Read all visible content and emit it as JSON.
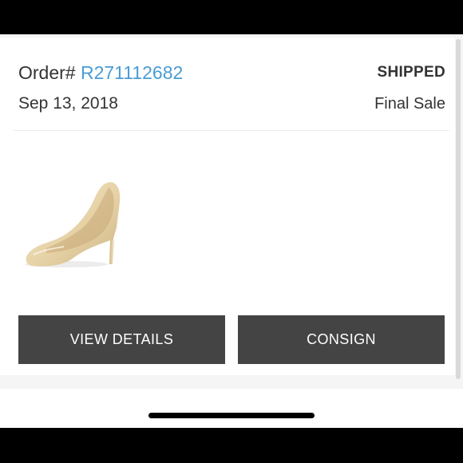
{
  "order": {
    "prefix": "Order# ",
    "number": "R271112682",
    "status": "SHIPPED",
    "date": "Sep 13, 2018",
    "sale_type": "Final Sale"
  },
  "product": {
    "image_icon": "nude-patent-pump-image"
  },
  "actions": {
    "view_details": "VIEW DETAILS",
    "consign": "CONSIGN"
  },
  "colors": {
    "link": "#4a9cd3",
    "button_bg": "#444444",
    "text": "#333333"
  }
}
